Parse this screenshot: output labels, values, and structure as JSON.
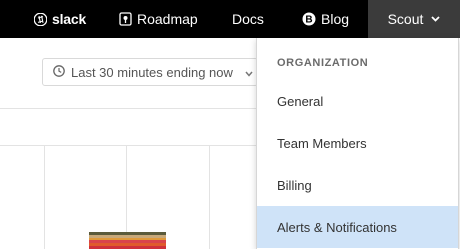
{
  "nav": {
    "slack_label": "slack",
    "roadmap_label": "Roadmap",
    "docs_label": "Docs",
    "blog_label": "Blog",
    "account_label": "Scout"
  },
  "time_selector": {
    "label": "Last 30 minutes ending now"
  },
  "dropdown": {
    "header": "ORGANIZATION",
    "items": [
      {
        "label": "General"
      },
      {
        "label": "Team Members"
      },
      {
        "label": "Billing"
      },
      {
        "label": "Alerts & Notifications",
        "active": true
      }
    ]
  },
  "colors": {
    "topbar": "#000000",
    "account_bg": "#3b3b3b",
    "active_item": "#cfe3f8",
    "bar_segments": [
      "#5b5b3b",
      "#c8a97a",
      "#e09a3a",
      "#d9434b",
      "#e05a2c",
      "#d0303a"
    ]
  },
  "icons": {
    "slack": "slack-logo-icon",
    "roadmap": "map-pin-icon",
    "blog": "blog-b-icon",
    "account": "chevron-down-icon",
    "time": "clock-icon",
    "time_caret": "chevron-down-icon"
  }
}
